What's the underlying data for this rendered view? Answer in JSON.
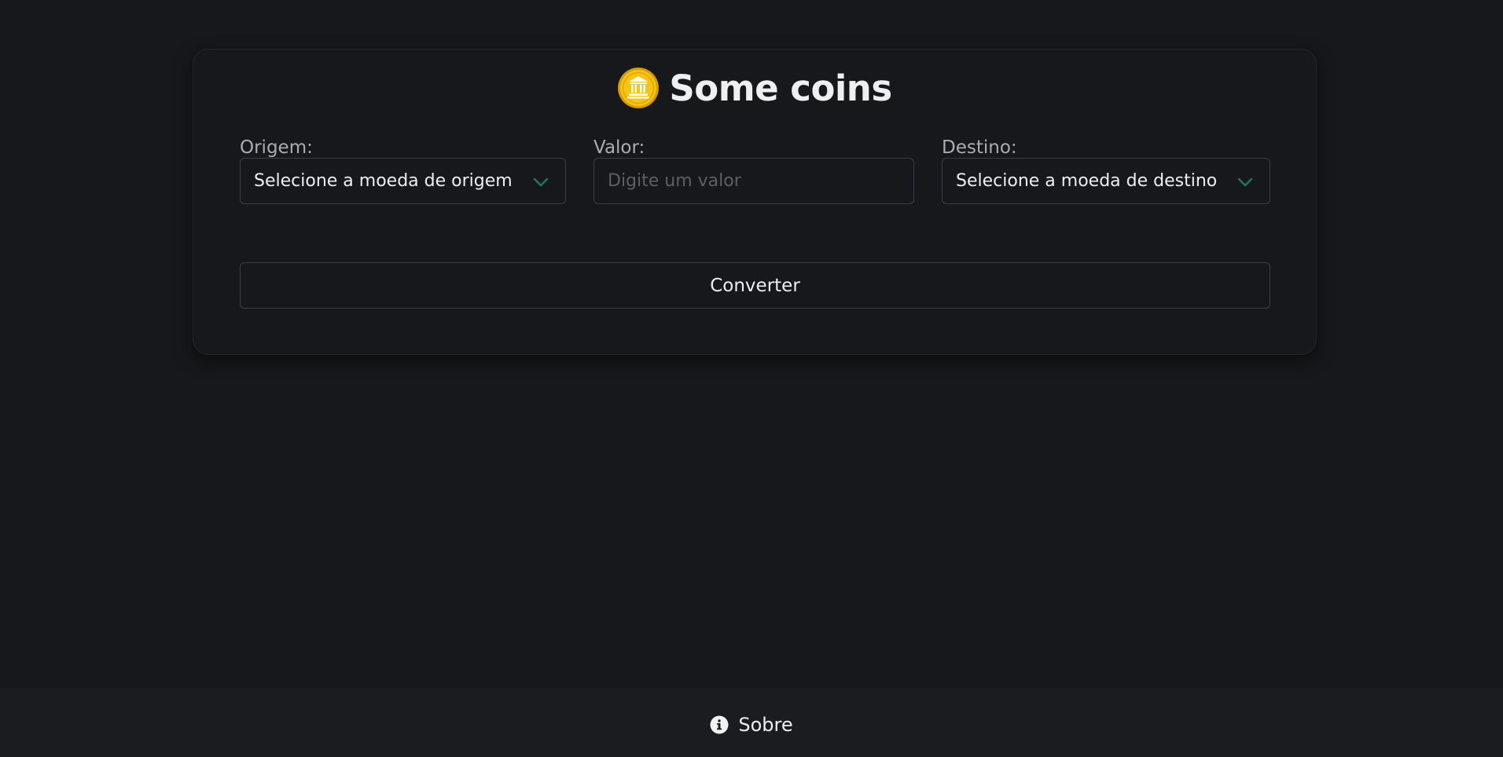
{
  "header": {
    "title": "Some coins",
    "icon": "bank-coin-icon"
  },
  "form": {
    "origin_label": "Origem:",
    "origin_value": "Selecione a moeda de origem",
    "amount_label": "Valor:",
    "amount_placeholder": "Digite um valor",
    "amount_value": "",
    "destination_label": "Destino:",
    "destination_value": "Selecione a moeda de destino",
    "convert_label": "Converter"
  },
  "footer": {
    "about_label": "Sobre",
    "about_icon": "info-icon"
  },
  "colors": {
    "background": "#17181b",
    "footer_background": "#1a1c20",
    "accent": "#1f7a5a",
    "coin_gold": "#f2b705"
  }
}
